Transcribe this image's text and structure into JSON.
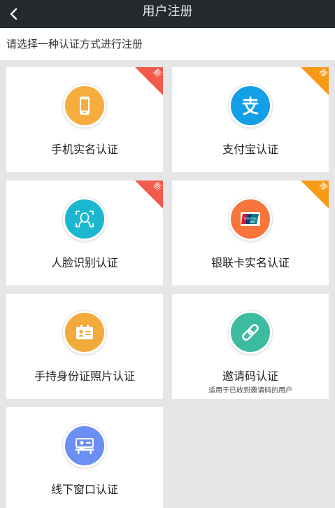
{
  "header": {
    "title": "用户注册",
    "back_icon": "chevron-left-icon"
  },
  "subtitle": "请选择一种认证方式进行注册",
  "colors": {
    "header_bg": "#252a2e",
    "ribbon_new": "#f25a4b",
    "ribbon_rec": "#f79a16"
  },
  "cards": [
    {
      "label": "手机实名认证",
      "badge": "新",
      "icon": "phone-icon",
      "color": "#f7ad3e"
    },
    {
      "label": "支付宝认证",
      "badge": "荐",
      "icon": "alipay-icon",
      "color": "#139fe5"
    },
    {
      "label": "人脸识别认证",
      "badge": "新",
      "icon": "face-icon",
      "color": "#1bb7cf"
    },
    {
      "label": "银联卡实名认证",
      "badge": "荐",
      "icon": "unionpay-card-icon",
      "color": "#f7743a",
      "icon_text": "UnionPay\n银联"
    },
    {
      "label": "手持身份证照片认证",
      "icon": "id-card-icon",
      "color": "#f2aa3b"
    },
    {
      "label": "邀请码认证",
      "note": "适用于已收到邀请码的用户",
      "icon": "link-icon",
      "color": "#3dbba1"
    },
    {
      "label": "线下窗口认证",
      "icon": "counter-icon",
      "color": "#6b8ff2"
    }
  ]
}
